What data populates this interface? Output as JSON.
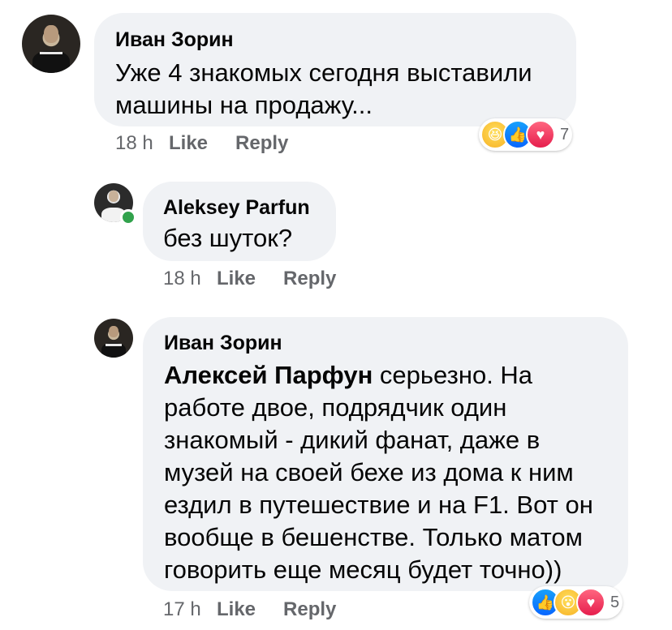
{
  "comments": [
    {
      "author": "Иван Зорин",
      "text": "Уже 4 знакомых сегодня выставили машины на продажу...",
      "line1": "Уже 4 знакомых сегодня выставили",
      "line2": "машины на продажу...",
      "time": "18 h",
      "like": "Like",
      "reply": "Reply",
      "reactions": [
        "haha-icon",
        "like-icon",
        "love-icon"
      ],
      "reaction_count": "7"
    },
    {
      "author": "Aleksey Parfun",
      "text": "без шуток?",
      "time": "18 h",
      "like": "Like",
      "reply": "Reply"
    },
    {
      "author": "Иван Зорин",
      "mention": "Алексей Парфун",
      "line1_rest": " серьезно. На",
      "line2": "работе двое, подрядчик один",
      "line3": "знакомый - дикий фанат, даже в",
      "line4": "музей на своей бехе из дома к ним",
      "line5": "ездил в путешествие и на F1. Вот он",
      "line6": "вообще в бешенстве. Только матом",
      "line7": "говорить еще месяц будет точно))",
      "time": "17 h",
      "like": "Like",
      "reply": "Reply",
      "reactions": [
        "like-icon",
        "wow-icon",
        "love-icon"
      ],
      "reaction_count": "5"
    }
  ],
  "colors": {
    "bubble": "#f0f2f5",
    "meta_text": "#65676b",
    "online": "#31a24c"
  }
}
